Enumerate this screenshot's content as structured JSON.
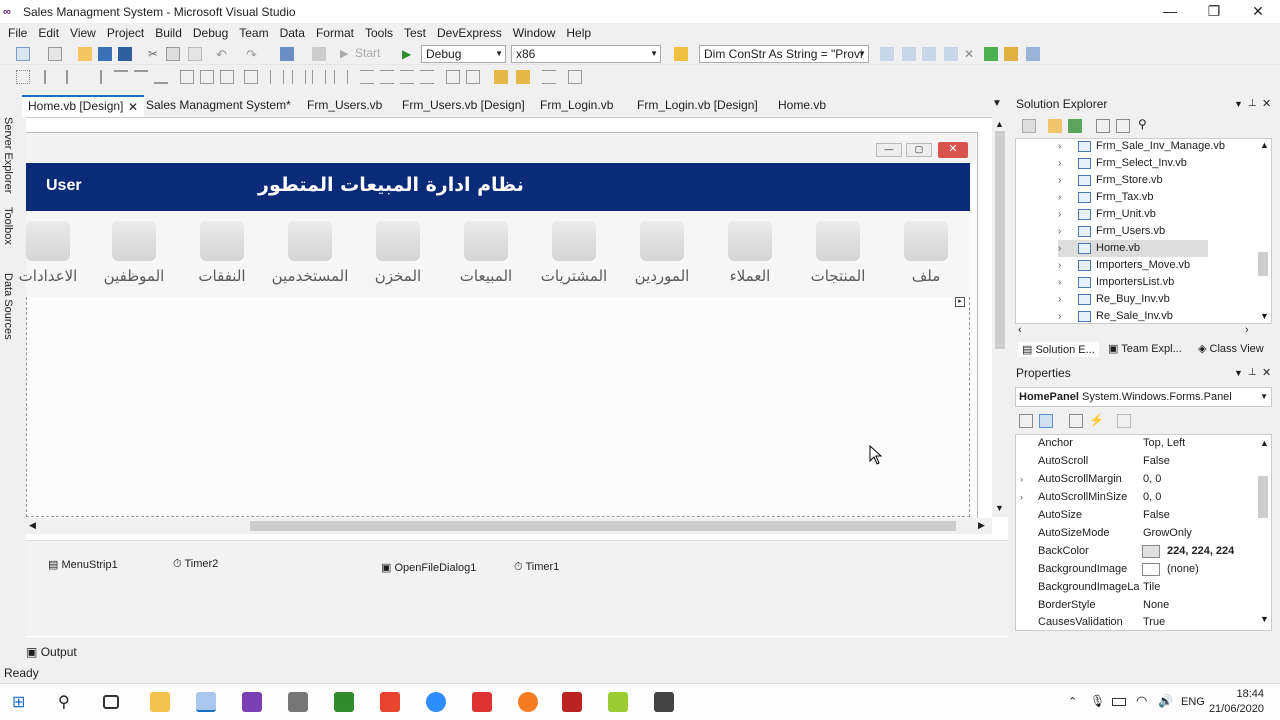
{
  "window": {
    "title": "Sales Managment System - Microsoft Visual Studio"
  },
  "menu": [
    "File",
    "Edit",
    "View",
    "Project",
    "Build",
    "Debug",
    "Team",
    "Data",
    "Format",
    "Tools",
    "Test",
    "DevExpress",
    "Window",
    "Help"
  ],
  "toolbar": {
    "start_label": "Start",
    "config": "Debug",
    "platform": "x86",
    "find_text": "Dim ConStr As String = \"Provi"
  },
  "tabs": [
    "Home.vb [Design]",
    "Sales Managment System*",
    "Frm_Users.vb",
    "Frm_Users.vb [Design]",
    "Frm_Login.vb",
    "Frm_Login.vb [Design]",
    "Home.vb"
  ],
  "left_strip": [
    "Server Explorer",
    "Toolbox",
    "Data Sources"
  ],
  "form": {
    "user_label": "User",
    "banner_title": "نظام ادارة المبيعات المتطور",
    "menu_items": [
      "ملف",
      "المنتجات",
      "العملاء",
      "الموردين",
      "المشتريات",
      "المبيعات",
      "المخزن",
      "المستخدمين",
      "النفقات",
      "الموظفين",
      "الاعدادات"
    ]
  },
  "tray": [
    "MenuStrip1",
    "Timer2",
    "OpenFileDialog1",
    "Timer1"
  ],
  "solution_explorer": {
    "title": "Solution Explorer",
    "items": [
      "Frm_Sale_Inv_Manage.vb",
      "Frm_Select_Inv.vb",
      "Frm_Store.vb",
      "Frm_Tax.vb",
      "Frm_Unit.vb",
      "Frm_Users.vb",
      "Home.vb",
      "Importers_Move.vb",
      "ImportersList.vb",
      "Re_Buy_Inv.vb",
      "Re_Sale_Inv.vb"
    ],
    "selected": "Home.vb",
    "tabs": [
      "Solution E...",
      "Team Expl...",
      "Class View"
    ]
  },
  "properties": {
    "title": "Properties",
    "object": "HomePanel",
    "object_type": "System.Windows.Forms.Panel",
    "rows": [
      {
        "name": "Anchor",
        "value": "Top, Left"
      },
      {
        "name": "AutoScroll",
        "value": "False"
      },
      {
        "name": "AutoScrollMargin",
        "value": "0, 0"
      },
      {
        "name": "AutoScrollMinSize",
        "value": "0, 0"
      },
      {
        "name": "AutoSize",
        "value": "False"
      },
      {
        "name": "AutoSizeMode",
        "value": "GrowOnly"
      },
      {
        "name": "BackColor",
        "value": "224, 224, 224"
      },
      {
        "name": "BackgroundImage",
        "value": "(none)"
      },
      {
        "name": "BackgroundImageLa",
        "value": "Tile"
      },
      {
        "name": "BorderStyle",
        "value": "None"
      },
      {
        "name": "CausesValidation",
        "value": "True"
      }
    ]
  },
  "output_label": "Output",
  "status": "Ready",
  "clock": {
    "time": "18:44",
    "date": "21/06/2020",
    "lang": "ENG"
  },
  "colors": {
    "banner": "#0b2a78",
    "accent": "#1a6ec0"
  }
}
